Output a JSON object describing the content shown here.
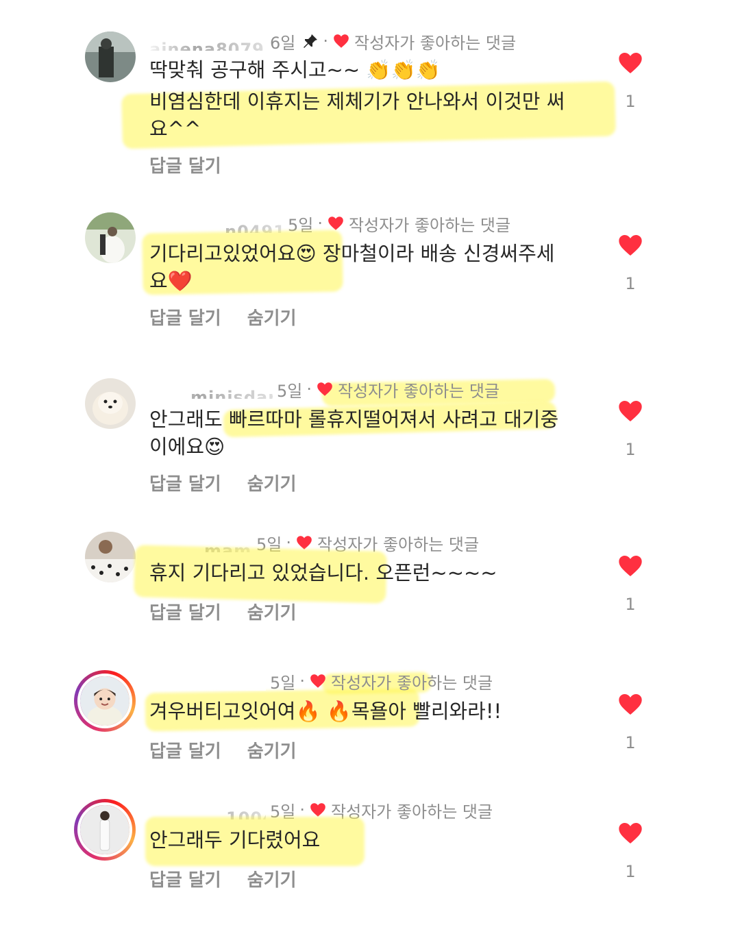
{
  "comments": [
    {
      "username": "ainena8079",
      "time": "6일",
      "liked_by_author": "작성자가 좋아하는 댓글",
      "text_line1": "딱맞춰 공구해 주시고~~ 👏👏👏",
      "text_line2": "비염심한데 이휴지는 제체기가 안나와서 이것만 써",
      "text_line3": "요^^",
      "reply": "답글 달기",
      "hide": "",
      "likes": "1"
    },
    {
      "username": "n0491",
      "time": "5일",
      "liked_by_author": "작성자가 좋아하는 댓글",
      "text_line1": "기다리고있었어요😍 장마철이라 배송 신경써주세",
      "text_line2": "요❤️",
      "reply": "답글 달기",
      "hide": "숨기기",
      "likes": "1"
    },
    {
      "username": "minisdar",
      "time": "5일",
      "liked_by_author": "작성자가 좋아하는 댓글",
      "text_line1": "안그래도 빠르따마 롤휴지떨어져서 사려고 대기중",
      "text_line2": "이에요😍",
      "reply": "답글 달기",
      "hide": "숨기기",
      "likes": "1"
    },
    {
      "username": "mami",
      "time": "5일",
      "liked_by_author": "작성자가 좋아하는 댓글",
      "text_line1": "휴지 기다리고 있었습니다.  오픈런~~~~",
      "reply": "답글 달기",
      "hide": "숨기기",
      "likes": "1"
    },
    {
      "username": "",
      "time": "5일",
      "liked_by_author": "작성자가 좋아하는 댓글",
      "text_line1": "겨우버티고잇어여🔥 🔥목욜아 빨리와라!!",
      "reply": "답글 달기",
      "hide": "숨기기",
      "likes": "1"
    },
    {
      "username": "1004",
      "time": "5일",
      "liked_by_author": "작성자가 좋아하는 댓글",
      "text_line1": "안그래두 기다렸어요",
      "reply": "답글 달기",
      "hide": "숨기기",
      "likes": "1"
    }
  ],
  "colors": {
    "heart": "#ff3040",
    "highlight": "#fff550",
    "muted": "#8e8e8e",
    "text": "#262626"
  },
  "icons": {
    "like": "heart-icon",
    "pin": "pin-icon",
    "author_like": "heart-small-icon"
  }
}
